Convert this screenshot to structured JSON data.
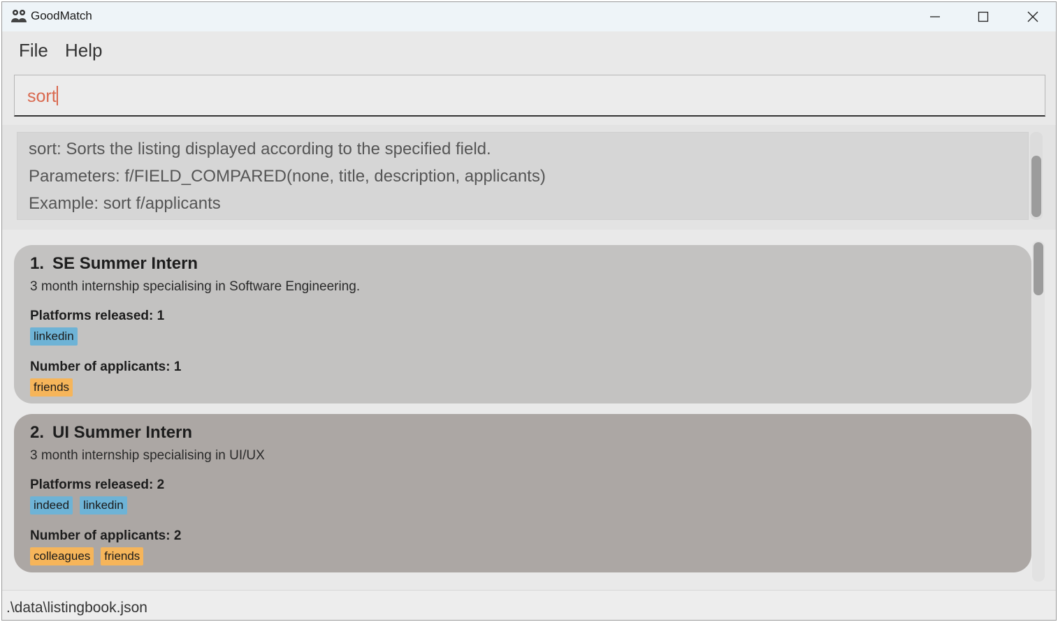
{
  "window": {
    "title": "GoodMatch"
  },
  "menu": {
    "file_label": "File",
    "help_label": "Help"
  },
  "command": {
    "value": "sort"
  },
  "result": {
    "lines": [
      "sort: Sorts the listing displayed according to the specified field.",
      "Parameters: f/FIELD_COMPARED(none, title, description, applicants)",
      "Example: sort f/applicants"
    ]
  },
  "listings": [
    {
      "index": "1.",
      "title": "SE Summer Intern",
      "description": "3 month internship specialising in Software Engineering.",
      "platforms_label": "Platforms released: 1",
      "platforms": [
        "linkedin"
      ],
      "applicants_label": "Number of applicants: 1",
      "applicants": [
        "friends"
      ]
    },
    {
      "index": "2.",
      "title": "UI Summer Intern",
      "description": "3 month internship specialising in UI/UX",
      "platforms_label": "Platforms released: 2",
      "platforms": [
        "indeed",
        "linkedin"
      ],
      "applicants_label": "Number of applicants: 2",
      "applicants": [
        "colleagues",
        "friends"
      ]
    }
  ],
  "status": {
    "path": ".\\data\\listingbook.json"
  },
  "colors": {
    "command_text": "#d9694f",
    "platform_tag": "#6eb3d6",
    "applicant_tag": "#f6b55a",
    "card_1_bg": "#c3c2c1",
    "card_2_bg": "#aca7a4"
  },
  "icons": {
    "app": "people-icon",
    "minimize": "minimize-icon",
    "maximize": "maximize-icon",
    "close": "close-icon"
  }
}
